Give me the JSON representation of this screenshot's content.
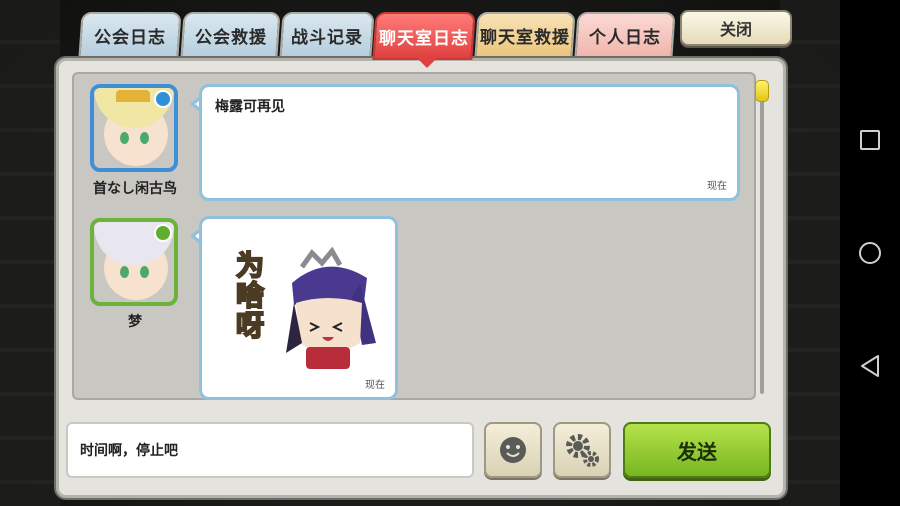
{
  "tabs": [
    {
      "label": "公会日志",
      "state": "inactive"
    },
    {
      "label": "公会救援",
      "state": "inactive"
    },
    {
      "label": "战斗记录",
      "state": "inactive"
    },
    {
      "label": "聊天室日志",
      "state": "active"
    },
    {
      "label": "聊天室救援",
      "state": "inactive"
    },
    {
      "label": "个人日志",
      "state": "inactive"
    }
  ],
  "close_label": "关闭",
  "messages": [
    {
      "user": "首なし闲古鸟",
      "text": "梅露可再见",
      "time": "现在",
      "avatar": "blonde-girl-crown",
      "badge_color": "#2f8fd8"
    },
    {
      "user": "梦",
      "sticker_text": "为啥呀",
      "time": "现在",
      "avatar": "silver-hair-girl",
      "badge_color": "#5fae2f"
    }
  ],
  "input": {
    "value": "时间啊，停止吧"
  },
  "send_label": "发送",
  "icons": {
    "emoji": "smiley-icon",
    "settings": "gears-icon"
  },
  "colors": {
    "active_tab": "#e0403f",
    "send_button": "#8ccc2c",
    "bubble_border": "#8fc1dd"
  }
}
